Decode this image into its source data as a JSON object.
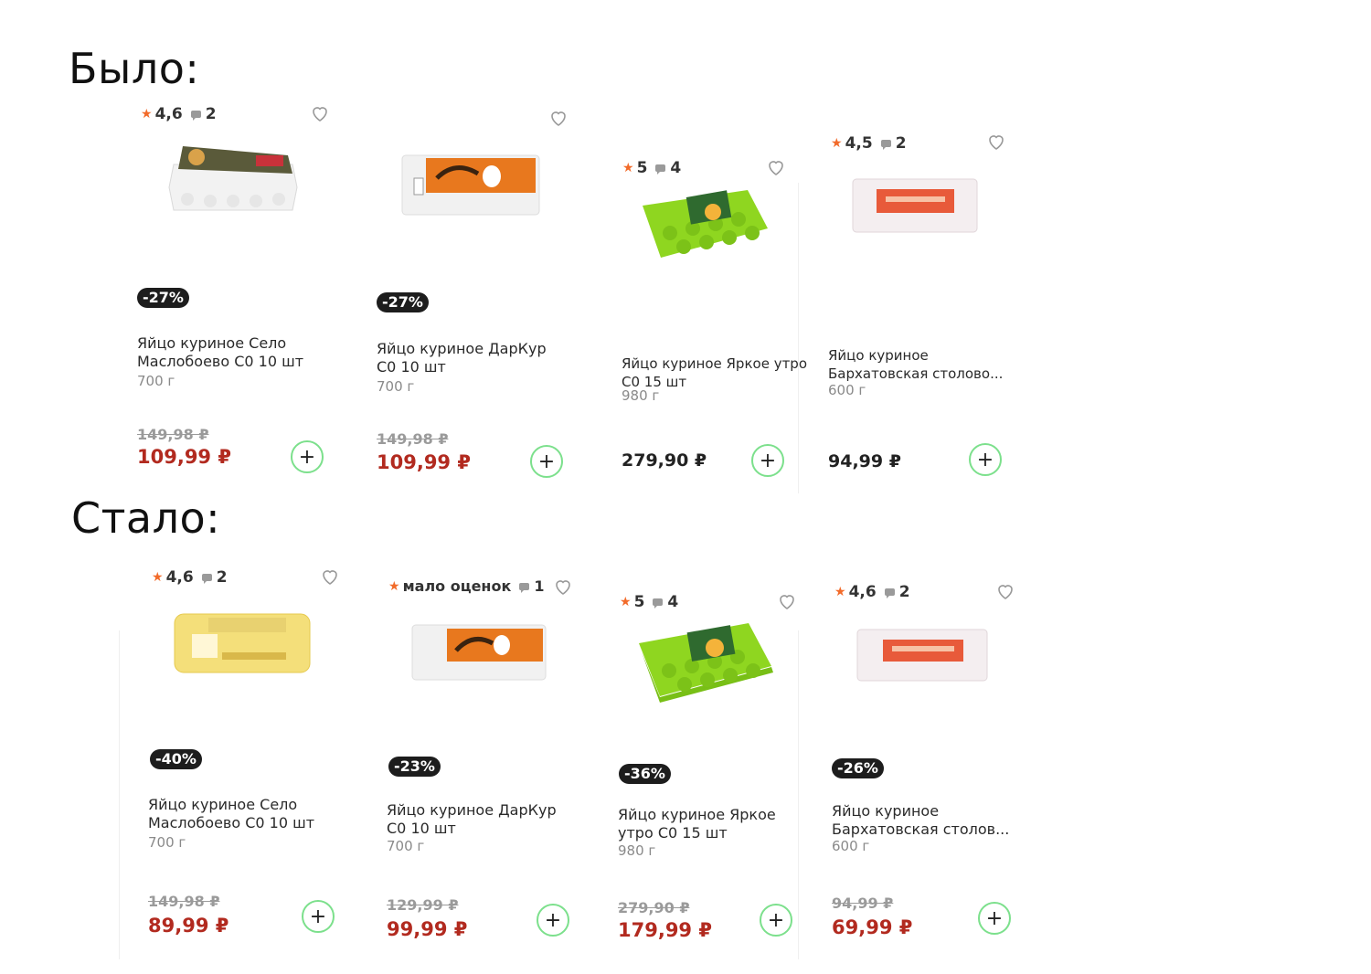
{
  "sections": {
    "before_title": "Было:",
    "after_title": "Стало:"
  },
  "before": [
    {
      "rating": "4,6",
      "reviews": "2",
      "badge": "-27%",
      "name": "Яйцо куриное Село Маслобоево С0 10 шт",
      "weight": "700 г",
      "old_price": "149,98 ₽",
      "price": "109,99 ₽",
      "img": "white-carton"
    },
    {
      "rating": "",
      "reviews": "",
      "badge": "-27%",
      "name": "Яйцо куриное ДарКур С0 10 шт",
      "weight": "700 г",
      "old_price": "149,98 ₽",
      "price": "109,99 ₽",
      "img": "orange-carton"
    },
    {
      "rating": "5",
      "reviews": "4",
      "badge": "",
      "name": "Яйцо куриное Яркое утро С0 15 шт",
      "weight": "980 г",
      "old_price": "",
      "price": "279,90 ₽",
      "img": "green-carton"
    },
    {
      "rating": "4,5",
      "reviews": "2",
      "badge": "",
      "name": "Яйцо куриное Бархатовская столово...",
      "weight": "600 г",
      "old_price": "",
      "price": "94,99 ₽",
      "img": "pink-carton"
    }
  ],
  "after": [
    {
      "rating": "4,6",
      "reviews": "2",
      "badge": "-40%",
      "name": "Яйцо куриное Село Маслобоево С0 10 шт",
      "weight": "700 г",
      "old_price": "149,98 ₽",
      "price": "89,99 ₽",
      "img": "yellow-carton"
    },
    {
      "rating": "мало оценок",
      "reviews": "1",
      "badge": "-23%",
      "name": "Яйцо куриное ДарКур С0 10 шт",
      "weight": "700 г",
      "old_price": "129,99 ₽",
      "price": "99,99 ₽",
      "img": "orange-carton"
    },
    {
      "rating": "5",
      "reviews": "4",
      "badge": "-36%",
      "name": "Яйцо куриное Яркое утро С0 15 шт",
      "weight": "980 г",
      "old_price": "279,90 ₽",
      "price": "179,99 ₽",
      "img": "green-carton"
    },
    {
      "rating": "4,6",
      "reviews": "2",
      "badge": "-26%",
      "name": "Яйцо куриное Бархатовская столов...",
      "weight": "600 г",
      "old_price": "94,99 ₽",
      "price": "69,99 ₽",
      "img": "pink-carton"
    }
  ],
  "add_label": "+",
  "colors": {
    "sale_price": "#b22a1f",
    "star": "#f26b2a",
    "add_border": "#7ce08c",
    "badge_bg": "#1d1d1d"
  }
}
